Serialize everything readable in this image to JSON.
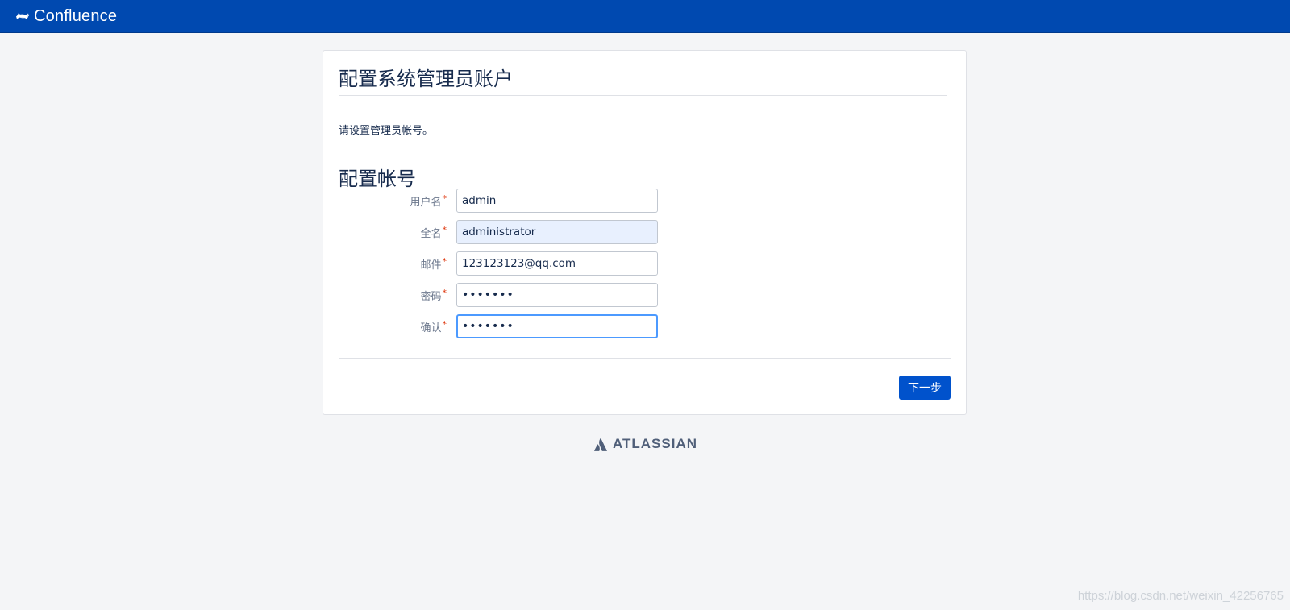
{
  "header": {
    "brand_name": "Confluence",
    "brand_icon": "confluence-logo-icon",
    "background_color": "#0049b0"
  },
  "page": {
    "title": "配置系统管理员账户",
    "intro": "请设置管理员帐号。",
    "section_title": "配置帐号"
  },
  "form": {
    "required_marker": "*",
    "fields": [
      {
        "label": "用户名",
        "value": "admin",
        "type": "text"
      },
      {
        "label": "全名",
        "value": "administrator",
        "type": "text"
      },
      {
        "label": "邮件",
        "value": "123123123@qq.com",
        "type": "email"
      },
      {
        "label": "密码",
        "value": "•••••••",
        "type": "password"
      },
      {
        "label": "确认",
        "value": "•••••••",
        "type": "password"
      }
    ]
  },
  "actions": {
    "next_label": "下一步",
    "accent_color": "#0052cc"
  },
  "footer": {
    "logo_text": "ATLASSIAN",
    "logo_icon": "atlassian-logo-icon"
  },
  "watermark": "https://blog.csdn.net/weixin_42256765"
}
